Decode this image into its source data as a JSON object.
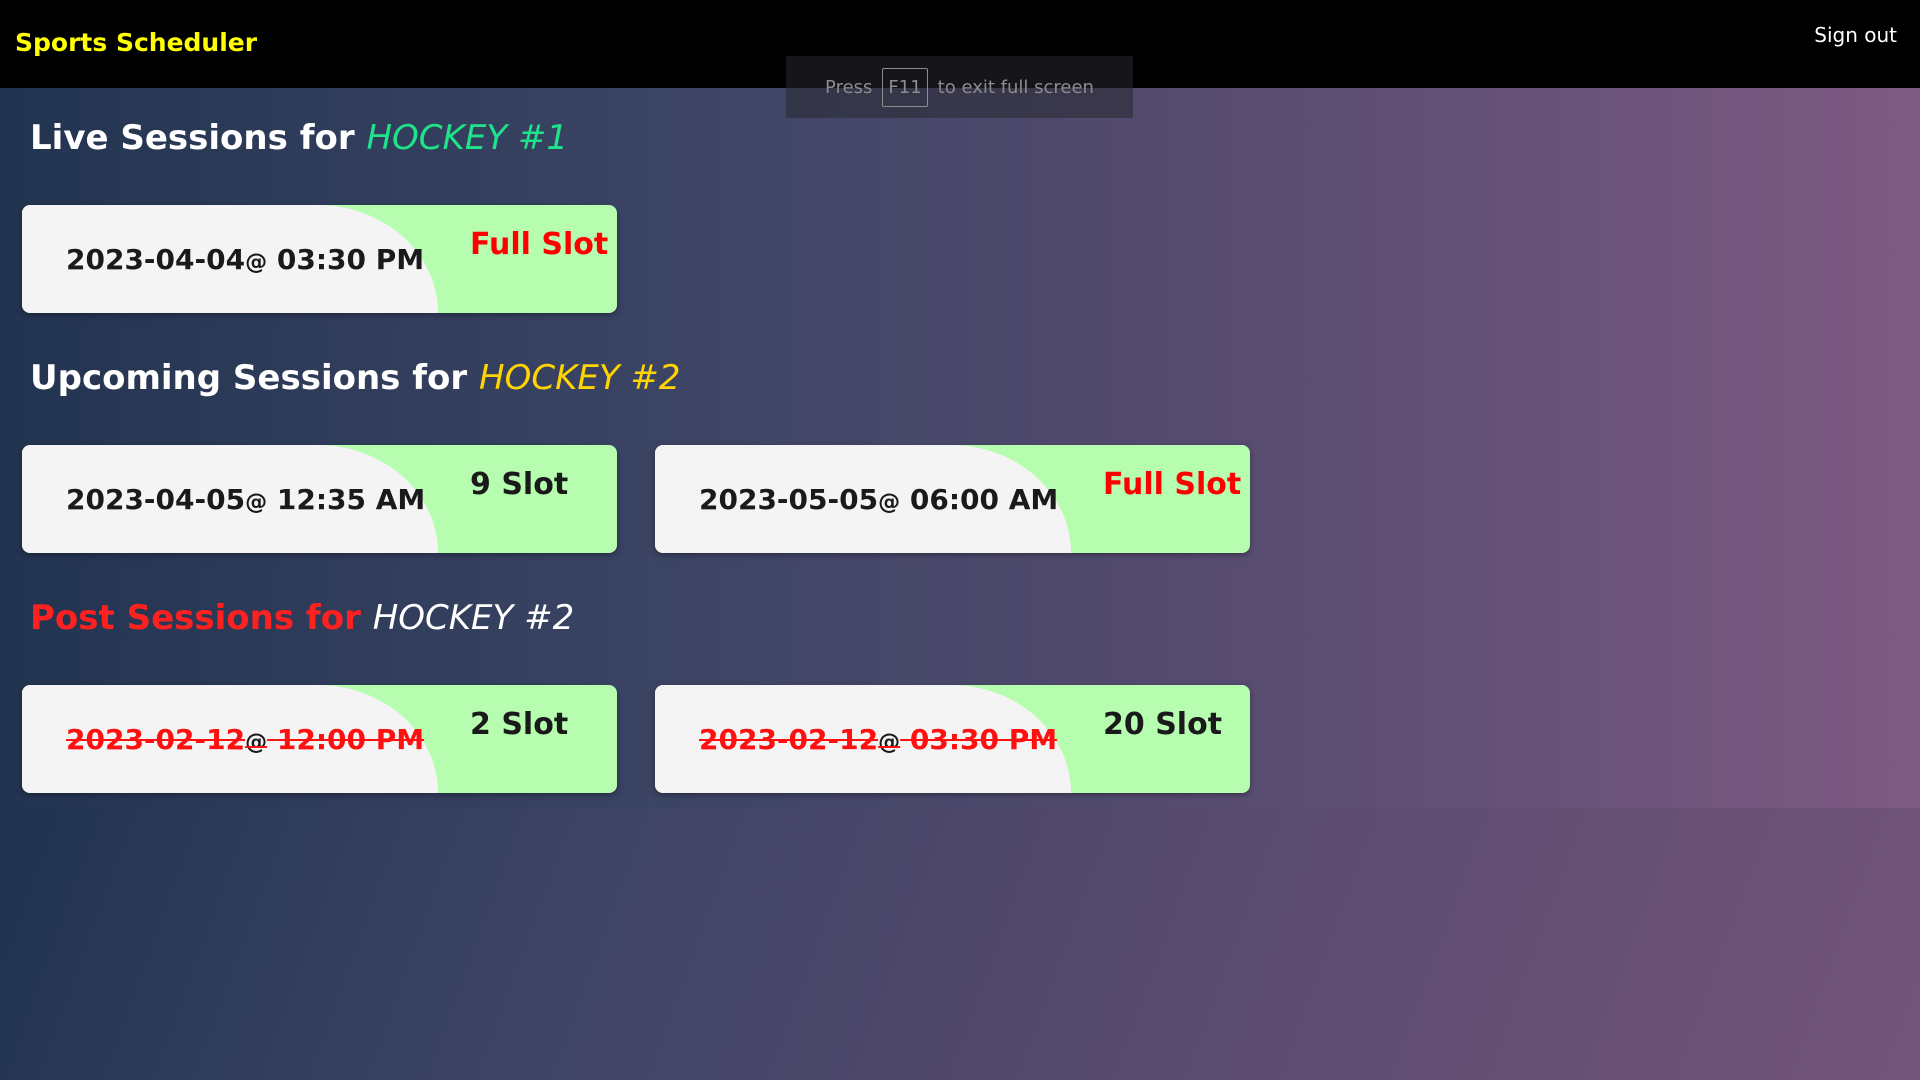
{
  "navbar": {
    "brand": "Sports Scheduler",
    "signout": "Sign out"
  },
  "fullscreen_notice": {
    "press": "Press",
    "key": "F11",
    "rest": "to exit full screen"
  },
  "live": {
    "prefix": "Live Sessions for",
    "sport": "HOCKEY #1",
    "sessions": [
      {
        "date": "2023-04-04",
        "at": "@",
        "time": "03:30 PM",
        "slot": "Full Slot"
      }
    ]
  },
  "upcoming": {
    "prefix": "Upcoming Sessions for",
    "sport": "HOCKEY #2",
    "sessions": [
      {
        "date": "2023-04-05",
        "at": "@",
        "time": "12:35 AM",
        "slot": "9 Slot"
      },
      {
        "date": "2023-05-05",
        "at": "@",
        "time": "06:00 AM",
        "slot": "Full Slot"
      }
    ]
  },
  "post": {
    "prefix": "Post Sessions for",
    "sport": "HOCKEY #2",
    "sessions": [
      {
        "date": "2023-02-12",
        "at": "@",
        "time": "12:00 PM",
        "slot": "2 Slot"
      },
      {
        "date": "2023-02-12",
        "at": "@",
        "time": "03:30 PM",
        "slot": "20 Slot"
      }
    ]
  },
  "colors": {
    "brand": "#ffff00",
    "live_sport": "#1fe38a",
    "upcoming_sport": "#ffd400",
    "post_prefix": "#ff2020",
    "full_slot": "#ff0000",
    "card_right": "#b7fdb0"
  }
}
